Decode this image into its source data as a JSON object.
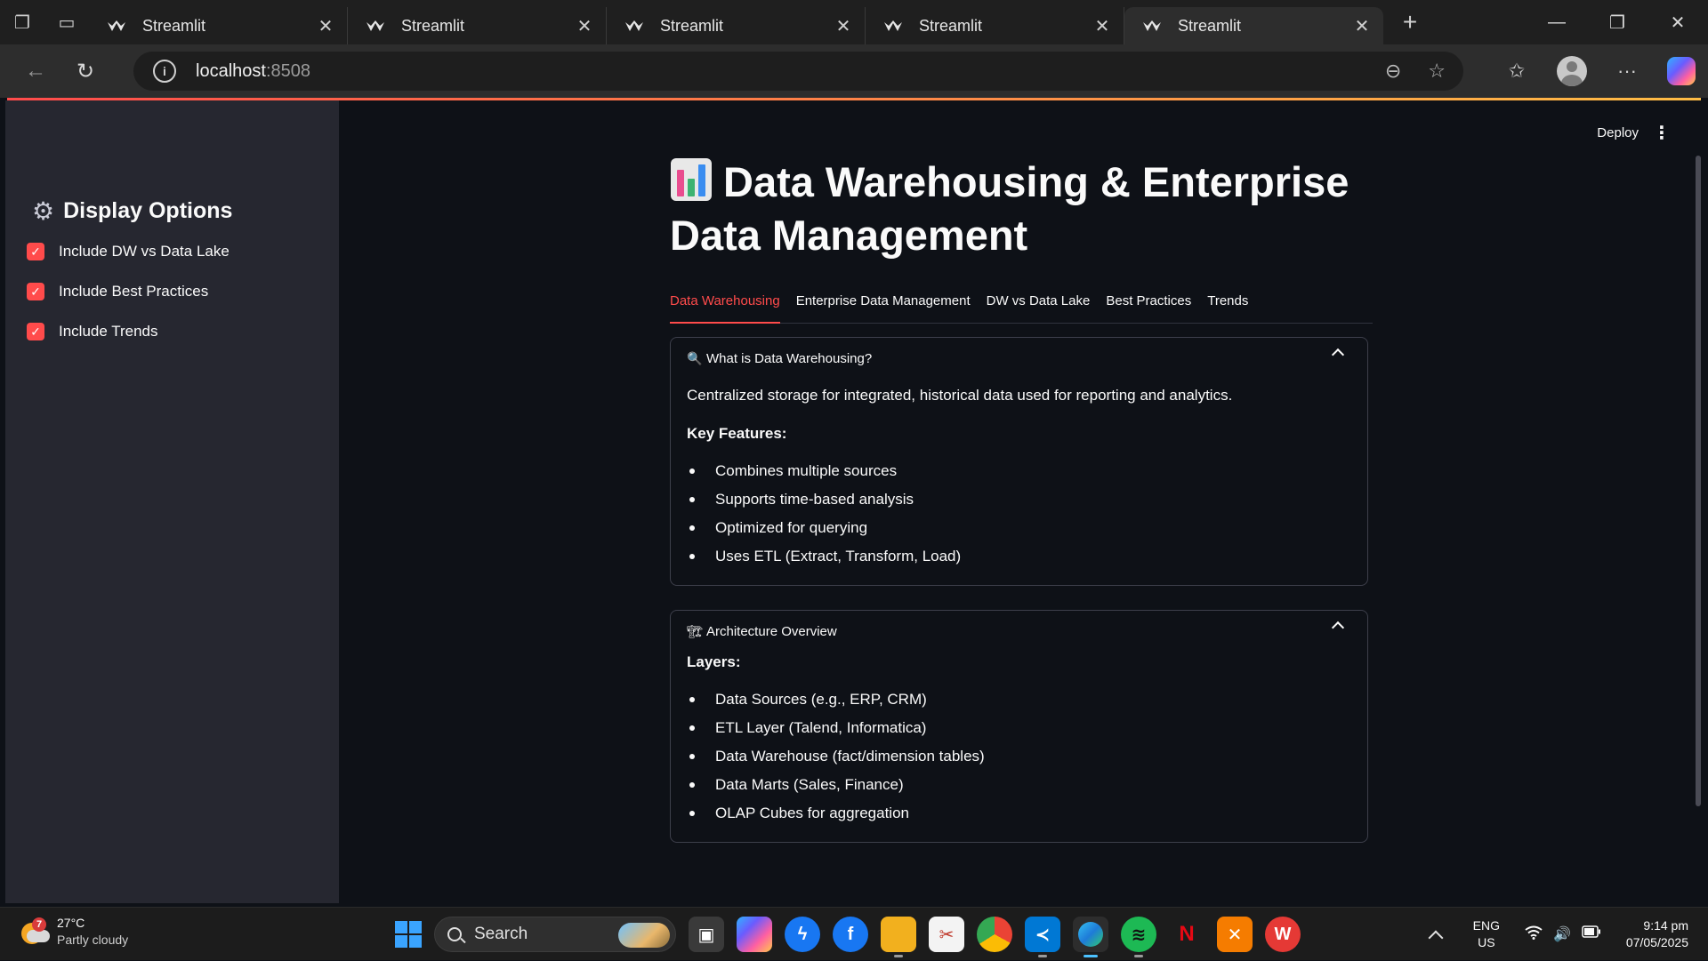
{
  "browser": {
    "tabs": [
      {
        "title": "Streamlit",
        "active": false
      },
      {
        "title": "Streamlit",
        "active": false
      },
      {
        "title": "Streamlit",
        "active": false
      },
      {
        "title": "Streamlit",
        "active": false
      },
      {
        "title": "Streamlit",
        "active": true
      }
    ],
    "address": {
      "host": "localhost",
      "port": ":8508"
    }
  },
  "app": {
    "header": {
      "deploy_label": "Deploy"
    },
    "sidebar": {
      "title": "Display Options",
      "options": [
        {
          "label": "Include DW vs Data Lake",
          "checked": true
        },
        {
          "label": "Include Best Practices",
          "checked": true
        },
        {
          "label": "Include Trends",
          "checked": true
        }
      ]
    },
    "main": {
      "title": "Data Warehousing & Enterprise Data Management",
      "tabs": [
        {
          "label": "Data Warehousing",
          "active": true
        },
        {
          "label": "Enterprise Data Management",
          "active": false
        },
        {
          "label": "DW vs Data Lake",
          "active": false
        },
        {
          "label": "Best Practices",
          "active": false
        },
        {
          "label": "Trends",
          "active": false
        }
      ],
      "expanders": [
        {
          "icon": "magnifier-icon",
          "title": "What is Data Warehousing?",
          "text": "Centralized storage for integrated, historical data used for reporting and analytics.",
          "subheading": "Key Features:",
          "items": [
            "Combines multiple sources",
            "Supports time-based analysis",
            "Optimized for querying",
            "Uses ETL (Extract, Transform, Load)"
          ]
        },
        {
          "icon": "building-icon",
          "title": "Architecture Overview",
          "subheading": "Layers:",
          "items": [
            "Data Sources (e.g., ERP, CRM)",
            "ETL Layer (Talend, Informatica)",
            "Data Warehouse (fact/dimension tables)",
            "Data Marts (Sales, Finance)",
            "OLAP Cubes for aggregation"
          ]
        }
      ]
    }
  },
  "taskbar": {
    "weather": {
      "temp": "27°C",
      "condition": "Partly cloudy",
      "badge": "7"
    },
    "search_label": "Search",
    "lang": {
      "line1": "ENG",
      "line2": "US"
    },
    "clock": {
      "time": "9:14 pm",
      "date": "07/05/2025"
    }
  },
  "colors": {
    "accent": "#ff4b4b",
    "sidebar_bg": "#262730",
    "app_bg": "#0e1117"
  }
}
